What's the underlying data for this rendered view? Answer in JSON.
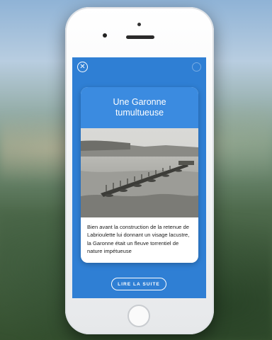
{
  "modal": {
    "title": "Une Garonne tumultueuse",
    "body": "Bien avant la construction de la retenue de Labrioulette lui donnant un visage lacustre, la Garonne était un fleuve torrentiel de nature impétueuse",
    "read_more_label": "LIRE LA SUITE",
    "close_icon": "close-icon",
    "photo": "historic-river-bridge-photo"
  },
  "colors": {
    "screen_blue": "#2f7fd4",
    "header_blue": "#3b8be0",
    "card_background": "#ffffff"
  }
}
